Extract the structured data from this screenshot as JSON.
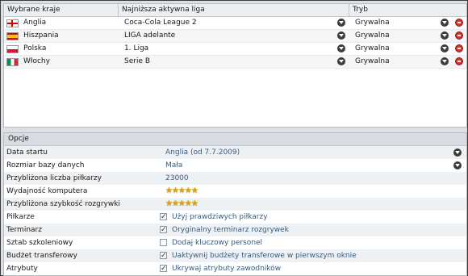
{
  "table": {
    "columns": [
      "Wybrane kraje",
      "Najniższa aktywna liga",
      "Tryb"
    ],
    "rows": [
      {
        "flag": "england-flag",
        "country": "Anglia",
        "league": "Coca-Cola League 2",
        "mode": "Grywalna"
      },
      {
        "flag": "spain-flag",
        "country": "Hiszpania",
        "league": "LIGA adelante",
        "mode": "Grywalna"
      },
      {
        "flag": "poland-flag",
        "country": "Polska",
        "league": "1. Liga",
        "mode": "Grywalna"
      },
      {
        "flag": "italy-flag",
        "country": "Włochy",
        "league": "Serie B",
        "mode": "Grywalna"
      }
    ]
  },
  "options": {
    "header": "Opcje",
    "rows": [
      {
        "label": "Data startu",
        "value": "Anglia (od 7.7.2009)",
        "kind": "dropdown"
      },
      {
        "label": "Rozmiar bazy danych",
        "value": "Mała",
        "kind": "dropdown"
      },
      {
        "label": "Przybliżona liczba piłkarzy",
        "value": "23000",
        "kind": "text"
      },
      {
        "label": "Wydajność komputera",
        "stars": 5,
        "kind": "stars"
      },
      {
        "label": "Przybliżona szybkość rozgrywki",
        "stars": 5,
        "kind": "stars"
      },
      {
        "label": "Piłkarze",
        "value": "Użyj prawdziwych piłkarzy",
        "checked": true,
        "kind": "checkbox"
      },
      {
        "label": "Terminarz",
        "value": "Oryginalny terminarz rozgrywek",
        "checked": true,
        "kind": "checkbox"
      },
      {
        "label": "Sztab szkoleniowy",
        "value": "Dodaj kluczowy personel",
        "checked": false,
        "kind": "checkbox"
      },
      {
        "label": "Budżet transferowy",
        "value": "Uaktywnij budżety transferowe w pierwszym oknie",
        "checked": true,
        "kind": "checkbox"
      },
      {
        "label": "Atrybuty",
        "value": "Ukrywaj atrybuty zawodników",
        "checked": true,
        "kind": "checkbox"
      }
    ]
  },
  "colors": {
    "value_text": "#3b5a7a",
    "remove_button": "#d9322a",
    "star": "#e8a100"
  }
}
